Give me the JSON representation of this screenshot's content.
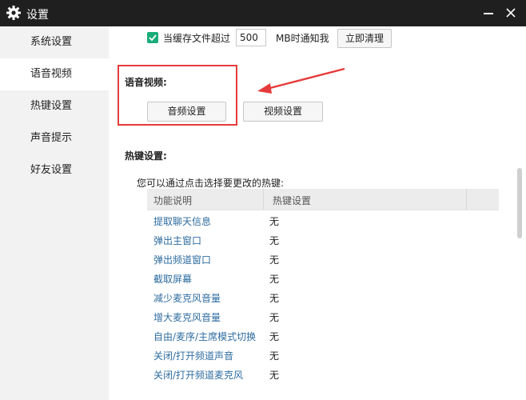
{
  "window": {
    "title": "设置"
  },
  "sidebar": {
    "items": [
      {
        "label": "系统设置"
      },
      {
        "label": "语音视频"
      },
      {
        "label": "热键设置"
      },
      {
        "label": "声音提示"
      },
      {
        "label": "好友设置"
      }
    ]
  },
  "cache": {
    "checked": true,
    "label_before": "当缓存文件超过",
    "value": "500",
    "label_after": "MB时通知我",
    "clear_button": "立即清理"
  },
  "voice_video": {
    "title": "语音视频:",
    "audio_button": "音频设置",
    "video_button": "视频设置"
  },
  "hotkeys": {
    "title": "热键设置:",
    "description": "您可以通过点击选择要更改的热键:",
    "columns": [
      "功能说明",
      "热键设置"
    ],
    "rows": [
      {
        "function": "提取聊天信息",
        "hotkey": "无"
      },
      {
        "function": "弹出主窗口",
        "hotkey": "无"
      },
      {
        "function": "弹出频道窗口",
        "hotkey": "无"
      },
      {
        "function": "截取屏幕",
        "hotkey": "无"
      },
      {
        "function": "减少麦克风音量",
        "hotkey": "无"
      },
      {
        "function": "增大麦克风音量",
        "hotkey": "无"
      },
      {
        "function": "自由/麦序/主席模式切换",
        "hotkey": "无"
      },
      {
        "function": "关闭/打开频道声音",
        "hotkey": "无"
      },
      {
        "function": "关闭/打开频道麦克风",
        "hotkey": "无"
      }
    ]
  },
  "colors": {
    "titlebar": "#1f1f1f",
    "sidebar": "#f2f2f2",
    "checkbox": "#1aad7a",
    "highlight": "#e53b3b",
    "link_text": "#2e6ca0"
  },
  "icons": [
    "gear-icon",
    "minimize-icon",
    "close-icon",
    "checkmark-icon",
    "arrow-annotation"
  ]
}
